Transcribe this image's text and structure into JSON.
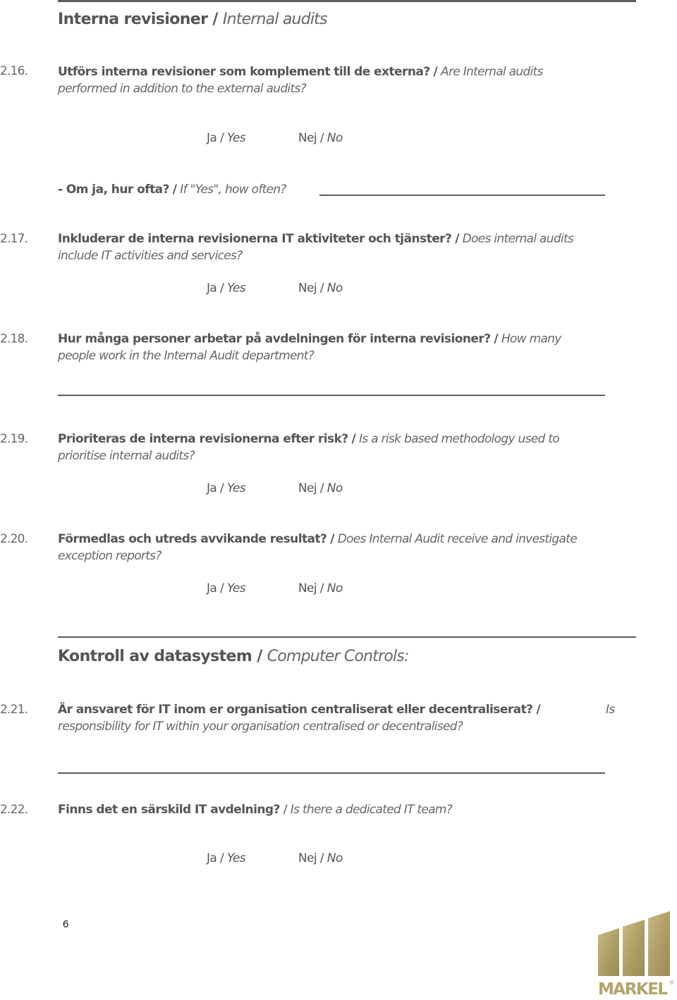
{
  "sections": [
    {
      "title_sv": "Interna revisioner",
      "sep": "/",
      "title_en": "Internal audits"
    },
    {
      "title_sv": "Kontroll av datasystem",
      "sep": "/",
      "title_en": "Computer Controls",
      "suffix": ":"
    }
  ],
  "answer_options": {
    "yes_sv": "Ja",
    "yes_en": "Yes",
    "no_sv": "Nej",
    "no_en": "No",
    "sep": "/"
  },
  "questions": [
    {
      "number": "2.16.",
      "sv": "Utförs interna revisioner som komplement till de externa?",
      "sep": "/",
      "en_line1": "Are Internal audits",
      "en_line2": "performed in addition to the external audits?"
    },
    {
      "number": "2.17.",
      "sv": "Inkluderar de interna revisionerna IT aktiviteter och tjänster?",
      "sep": "/",
      "en_line1": "Does internal audits",
      "en_line2": "include IT activities and services?"
    },
    {
      "number": "2.18.",
      "sv": "Hur många personer arbetar på avdelningen för interna revisioner?",
      "sep": "/",
      "en_line1": "How many",
      "en_line2": "people work in the Internal Audit department?"
    },
    {
      "number": "2.19.",
      "sv": "Prioriteras de interna revisionerna efter risk?",
      "sep": "/",
      "en_line1": "Is a risk based methodology used to",
      "en_line2": "prioritise internal audits?"
    },
    {
      "number": "2.20.",
      "sv": "Förmedlas och utreds avvikande resultat?",
      "sep": "/",
      "en_line1": "Does Internal Audit receive and investigate",
      "en_line2": "exception reports?"
    },
    {
      "number": "2.21.",
      "sv": "Är ansvaret för IT inom er organisation centraliserat eller decentraliserat?",
      "sep": "/",
      "en_line1": "Is",
      "en_line2": "responsibility for IT within your organisation centralised or decentralised?"
    },
    {
      "number": "2.22.",
      "sv": "Finns det en särskild IT avdelning?",
      "sep": "/",
      "en_line1": "Is there a dedicated IT team?"
    }
  ],
  "followup": {
    "prefix": "- Om ja, hur ofta?",
    "sep": "/",
    "en": "If \"Yes\", how often?"
  },
  "footer": {
    "page_number": "6",
    "logo_text": "MARKEL",
    "logo_mark": "®"
  },
  "colors": {
    "text": "#555555",
    "rule": "#5f5f5f",
    "logo_gold": "#b4a36a"
  }
}
